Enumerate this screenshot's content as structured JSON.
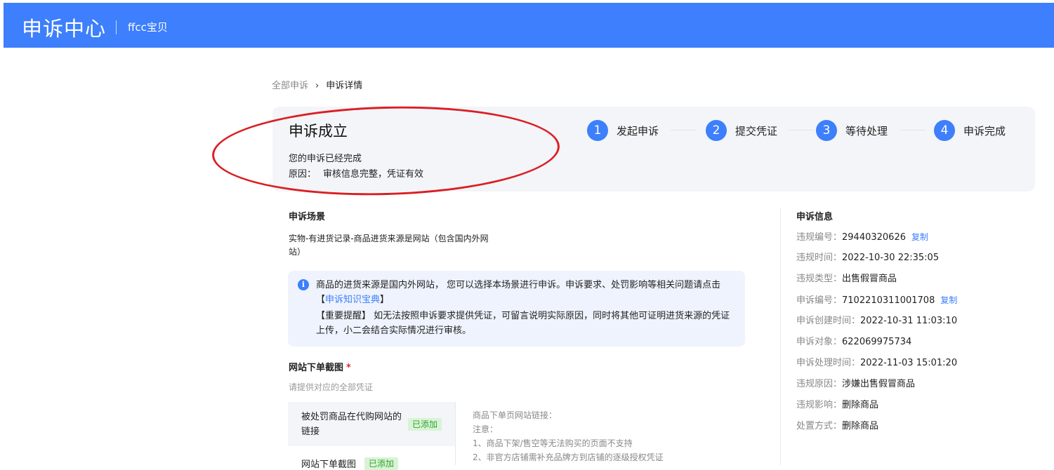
{
  "header": {
    "app_title": "申诉中心",
    "shop_name": "ffcc宝贝",
    "bg_color": "#3d7ffc"
  },
  "breadcrumb": {
    "parent": "全部申诉",
    "separator": "›",
    "current": "申诉详情"
  },
  "status": {
    "title": "申诉成立",
    "desc": "您的申诉已经完成",
    "reason_label": "原因：",
    "reason_value": "审核信息完整，凭证有效"
  },
  "steps": [
    {
      "num": "1",
      "label": "发起申诉"
    },
    {
      "num": "2",
      "label": "提交凭证"
    },
    {
      "num": "3",
      "label": "等待处理"
    },
    {
      "num": "4",
      "label": "申诉完成"
    }
  ],
  "scene": {
    "title": "申诉场景",
    "text": "实物-有进货记录-商品进货来源是网站（包含国内外网站）"
  },
  "notice": {
    "p1_prefix": "商品的进货来源是国内外网站， 您可以选择本场景进行申诉。申诉要求、处罚影响等相关问题请点击【",
    "p1_link": "申诉知识宝典",
    "p1_suffix": "】",
    "p2": "【重要提醒】 如无法按照申诉要求提供凭证，可留言说明实际原因，同时将其他可证明进货来源的凭证上传，小二会结合实际情况进行审核。"
  },
  "upload": {
    "title": "网站下单截图",
    "required_mark": "*",
    "hint": "请提供对应的全部凭证",
    "items": [
      {
        "label": "被处罚商品在代购网站的链接",
        "badge": "已添加"
      },
      {
        "label": "网站下单截图",
        "badge": "已添加"
      }
    ],
    "detail_lines": [
      "商品下单页网站链接：",
      "注意：",
      "1、商品下架/售空等无法购买的页面不支持",
      "2、非官方店铺需补充品牌方到店铺的逐级授权凭证"
    ]
  },
  "info": {
    "title": "申诉信息",
    "copy_label": "复制",
    "rows": [
      {
        "key": "违规编号：",
        "value": "29440320626",
        "copy": true
      },
      {
        "key": "违规时间：",
        "value": "2022-10-30 22:35:05"
      },
      {
        "key": "违规类型：",
        "value": "出售假冒商品"
      },
      {
        "key": "申诉编号：",
        "value": "7102210311001708",
        "copy": true
      },
      {
        "key": "申诉创建时间：",
        "value": "2022-10-31 11:03:10"
      },
      {
        "key": "申诉对象：",
        "value": "622069975734"
      },
      {
        "key": "申诉处理时间：",
        "value": "2022-11-03 15:01:20"
      },
      {
        "key": "违规原因：",
        "value": "涉嫌出售假冒商品"
      },
      {
        "key": "违规影响：",
        "value": "删除商品"
      },
      {
        "key": "处置方式：",
        "value": "删除商品"
      }
    ]
  },
  "icons": {
    "info": "info-circle-icon",
    "chevron": "chevron-right-icon"
  },
  "colors": {
    "accent": "#3d7ffc",
    "annotation": "#dc1e24",
    "success_badge_bg": "#d9f3d6",
    "success_badge_text": "#2fa52f",
    "required": "#e0292f"
  }
}
